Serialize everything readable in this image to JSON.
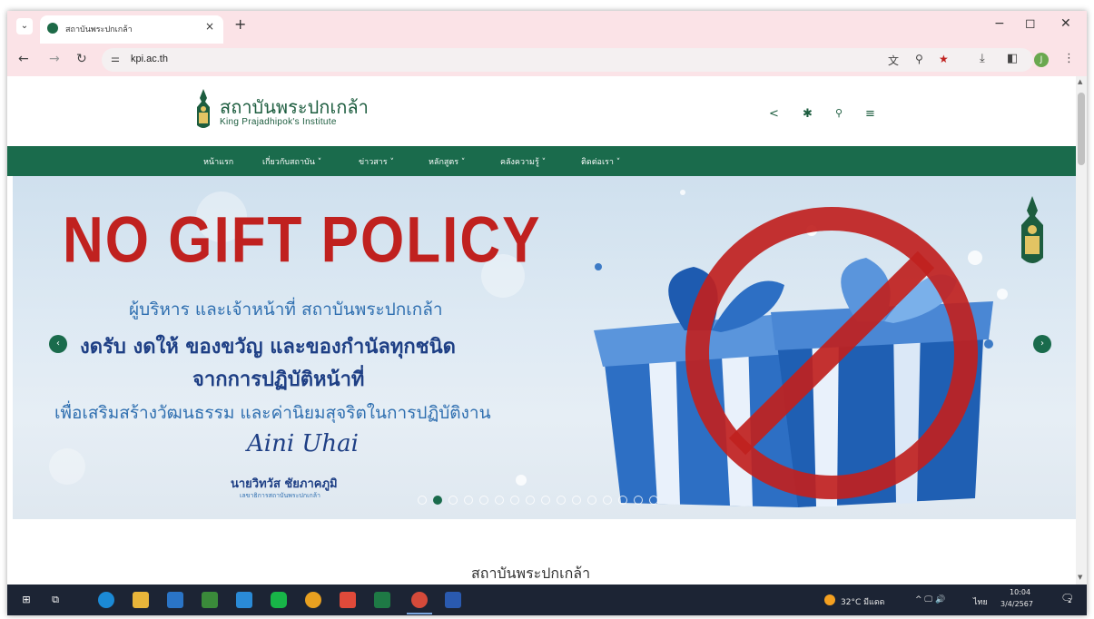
{
  "browser": {
    "tab_title": "สถาบันพระปกเกล้า",
    "tab_close": "×",
    "new_tab": "+",
    "url": "kpi.ac.th",
    "window_controls": [
      "−",
      "◻",
      "✕"
    ],
    "profile_initial": "J",
    "icons": [
      "back-icon",
      "forward-icon",
      "reload-icon",
      "site-settings-icon",
      "translate-icon",
      "zoom-icon",
      "bookmark-star-icon",
      "download-icon",
      "sidepanel-icon",
      "menu-dots-icon"
    ]
  },
  "site": {
    "logo_thai": "สถาบันพระปกเกล้า",
    "logo_en": "King Prajadhipok's Institute",
    "nav": [
      {
        "label": "หน้าแรก"
      },
      {
        "label": "เกี่ยวกับสถาบัน ˅"
      },
      {
        "label": "ข่าวสาร ˅"
      },
      {
        "label": "หลักสูตร ˅"
      },
      {
        "label": "คลังความรู้ ˅"
      },
      {
        "label": "ติดต่อเรา ˅"
      }
    ],
    "header_icons": [
      "share-icon",
      "settings-icon",
      "search-icon",
      "hamburger-menu-icon"
    ]
  },
  "hero": {
    "title": "NO GIFT POLICY",
    "line1": "ผู้บริหาร และเจ้าหน้าที่ สถาบันพระปกเกล้า",
    "line2": "งดรับ งดให้ ของขวัญ และของกำนัลทุกชนิด",
    "line3": "จากการปฏิบัติหน้าที่",
    "line4": "เพื่อเสริมสร้างวัฒนธรรม และค่านิยมสุจริตในการปฏิบัติงาน",
    "signature": "Aini Uhai",
    "signer_name": "นายวิทวัส ชัยภาคภูมิ",
    "signer_title": "เลขาธิการสถาบันพระปกเกล้า",
    "slide_count": 16,
    "active_slide": 2,
    "colors": {
      "title": "#c0211f",
      "text": "#1e3f85",
      "accent": "#1a6b4c"
    }
  },
  "section": {
    "title": "สถาบันพระปกเกล้า"
  },
  "taskbar": {
    "apps": [
      "start-icon",
      "task-view-icon",
      "edge-icon",
      "file-explorer-icon",
      "store-icon",
      "analytics-icon",
      "mail-icon",
      "line-icon",
      "chrome-icon",
      "acrobat-icon",
      "excel-icon",
      "chrome-active-icon",
      "word-icon"
    ],
    "weather": "32°C มีแดด",
    "tray_symbols": "^ 🖵 🔊",
    "language": "ไทย",
    "time": "10:04",
    "date": "3/4/2567",
    "notification_count": "2"
  }
}
